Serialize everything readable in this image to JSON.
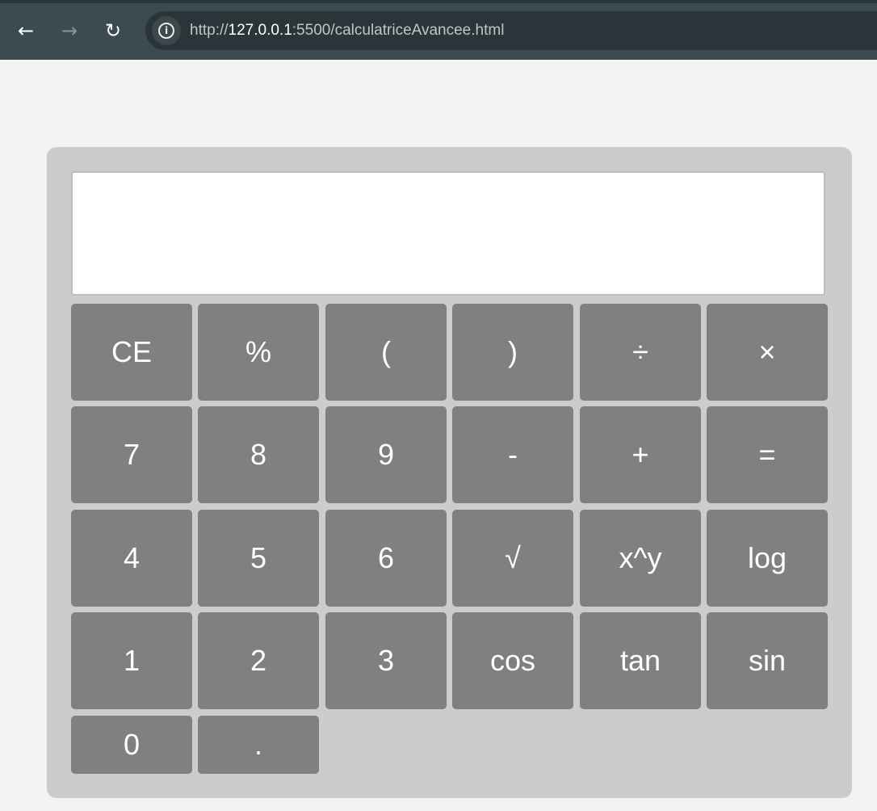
{
  "browser": {
    "url_scheme": "http://",
    "url_host": "127.0.0.1",
    "url_rest": ":5500/calculatriceAvancee.html"
  },
  "calculator": {
    "display_value": "",
    "keys": {
      "ce": "CE",
      "percent": "%",
      "open_paren": "(",
      "close_paren": ")",
      "divide": "÷",
      "multiply": "×",
      "seven": "7",
      "eight": "8",
      "nine": "9",
      "minus": "-",
      "plus": "+",
      "equals": "=",
      "four": "4",
      "five": "5",
      "six": "6",
      "sqrt": "√",
      "power": "x^y",
      "log": "log",
      "one": "1",
      "two": "2",
      "three": "3",
      "cos": "cos",
      "tan": "tan",
      "sin": "sin",
      "zero": "0",
      "dot": "."
    }
  }
}
